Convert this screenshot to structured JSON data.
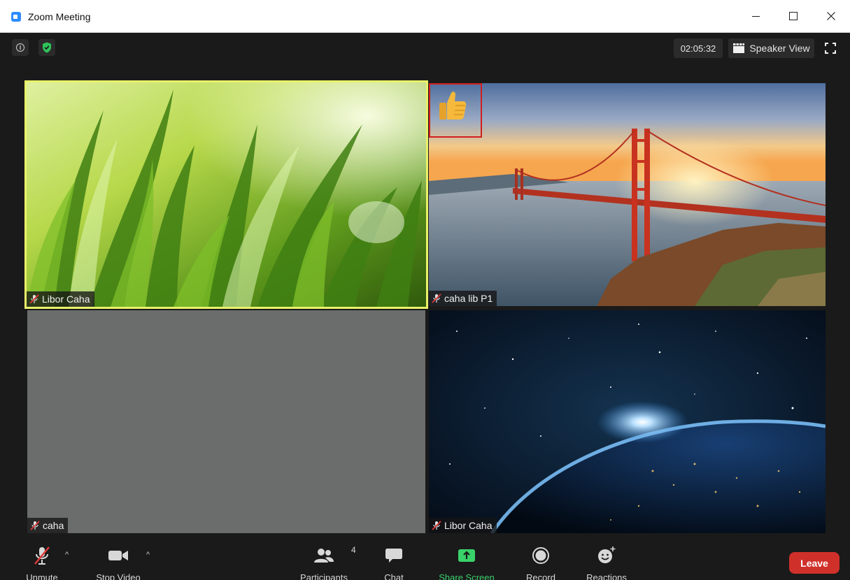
{
  "window": {
    "title": "Zoom Meeting",
    "app_icon": "zoom-camera-icon"
  },
  "top_bar": {
    "timer": "02:05:32",
    "view_label": "Speaker View",
    "icons": [
      "info-icon",
      "shield-check-icon",
      "speaker-view-icon",
      "fullscreen-icon"
    ]
  },
  "participants": [
    {
      "name": "Libor Caha",
      "muted": true,
      "active_speaker": true,
      "background": "green grass"
    },
    {
      "name": "caha lib P1",
      "muted": true,
      "active_speaker": false,
      "background": "golden gate bridge",
      "reaction": "thumbs-up"
    },
    {
      "name": "caha",
      "muted": true,
      "active_speaker": false,
      "background": "none"
    },
    {
      "name": "Libor Caha",
      "muted": true,
      "active_speaker": false,
      "background": "earth from space"
    }
  ],
  "toolbar": {
    "unmute": "Unmute",
    "stop_video": "Stop Video",
    "participants": "Participants",
    "participants_count": "4",
    "chat": "Chat",
    "share_screen": "Share Screen",
    "record": "Record",
    "reactions": "Reactions",
    "leave": "Leave"
  },
  "colors": {
    "active_speaker_border": "#e9f26a",
    "share_screen": "#39d26a",
    "leave": "#d0302a",
    "highlight_box": "#d11f1f"
  }
}
